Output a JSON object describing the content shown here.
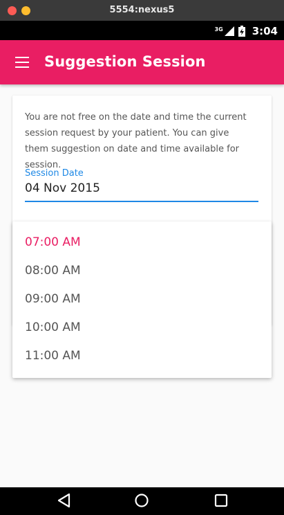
{
  "window": {
    "title": "5554:nexus5"
  },
  "status_bar": {
    "network_type": "3G",
    "time": "3:04"
  },
  "app_bar": {
    "title": "Suggestion Session",
    "menu_icon": "hamburger-menu-icon"
  },
  "card": {
    "message": "You are not free on the date and time the current session request by your patient. You can give them suggestion on date and time available for session.",
    "date_field": {
      "label": "Session Date",
      "value": "04 Nov 2015"
    }
  },
  "time_dropdown": {
    "selected_index": 0,
    "options": [
      "07:00 AM",
      "08:00 AM",
      "09:00 AM",
      "10:00 AM",
      "11:00 AM"
    ]
  },
  "colors": {
    "accent": "#e91e63",
    "field_focus": "#1e88e5"
  },
  "nav_bar": {
    "icons": [
      "back-icon",
      "home-icon",
      "recents-icon"
    ]
  }
}
